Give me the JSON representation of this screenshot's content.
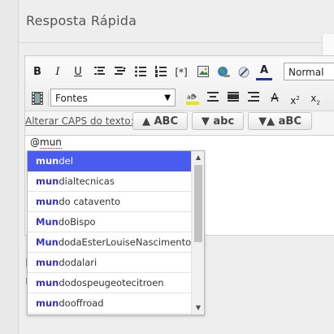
{
  "panel": {
    "title": "Resposta Rápida"
  },
  "toolbar": {
    "row1": [
      {
        "name": "bold-button",
        "label": "B"
      },
      {
        "name": "italic-button",
        "label": "I"
      },
      {
        "name": "underline-button",
        "label": "U"
      },
      {
        "name": "align-left-button",
        "icon": "align-left-icon"
      },
      {
        "name": "align-justify-button",
        "icon": "align-justify-icon"
      },
      {
        "name": "bullet-list-button",
        "icon": "bullet-list-icon"
      },
      {
        "name": "numbered-list-button",
        "icon": "numbered-list-icon"
      },
      {
        "name": "insert-tag-button",
        "label": "[*]"
      },
      {
        "name": "insert-image-button",
        "icon": "image-icon"
      },
      {
        "name": "insert-link-button",
        "icon": "globe-link-icon"
      },
      {
        "name": "unlink-button",
        "icon": "unlink-icon"
      },
      {
        "name": "text-color-button",
        "label": "A"
      }
    ],
    "format_select": "Normal",
    "font_select": "Fontes",
    "row2_icons": [
      "film-icon",
      "highlight-icon",
      "align-center-icon",
      "justify-icon",
      "align-right-icon",
      "strikethrough-icon",
      "superscript-icon",
      "subscript-icon"
    ]
  },
  "caps": {
    "label": "Alterar CAPS do texto:",
    "upper": "▲ ABC",
    "lower": "▼ abc",
    "toggle": "▼▲ aBC"
  },
  "editor": {
    "typed_prefix": "@",
    "typed_word": "mun"
  },
  "autocomplete": {
    "match": "mun",
    "items": [
      {
        "match": "mun",
        "rest": "del",
        "selected": true
      },
      {
        "match": "mun",
        "rest": "dialtecnicas"
      },
      {
        "match": "mun",
        "rest": "do catavento"
      },
      {
        "match": "Mun",
        "rest": "doBispo"
      },
      {
        "match": "Mun",
        "rest": "dodaEsterLouiseNascimento"
      },
      {
        "match": "mun",
        "rest": "dodalari"
      },
      {
        "match": "mun",
        "rest": "dodospeugeotecitroen"
      },
      {
        "match": "mun",
        "rest": "dooffroad"
      }
    ],
    "scroll_up": "▲",
    "scroll_down": "▼"
  }
}
